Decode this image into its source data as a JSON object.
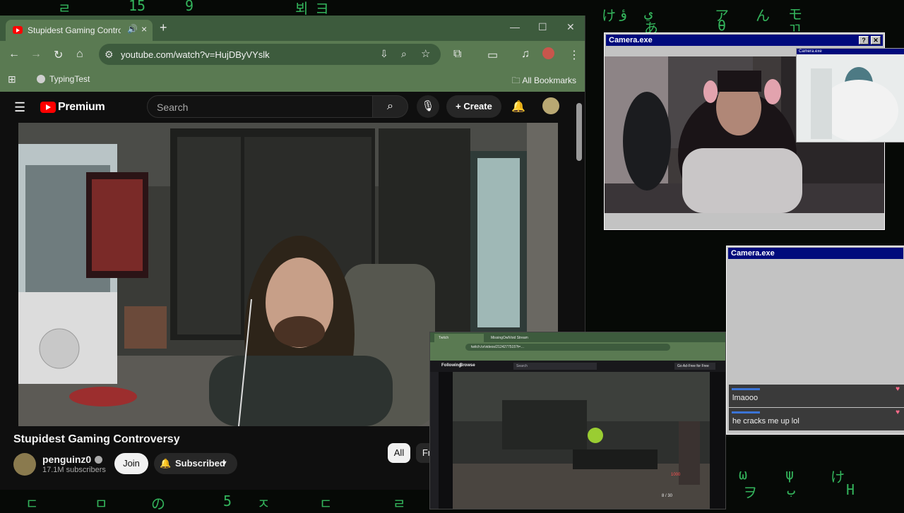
{
  "browser": {
    "tab": {
      "title": "Stupidest Gaming Controversy",
      "close_glyph": "×"
    },
    "new_tab_glyph": "+",
    "window_controls": {
      "minimize": "—",
      "maximize": "☐",
      "close": "✕"
    },
    "url": "youtube.com/watch?v=HujDByVYslk",
    "bookmarks": [
      {
        "label": "TypingTest"
      }
    ],
    "all_bookmarks_label": "All Bookmarks",
    "theme": {
      "frame": "#3d5b3d",
      "toolbar": "#5a7a52"
    }
  },
  "youtube": {
    "brand": "Premium",
    "search_placeholder": "Search",
    "create_label": "Create",
    "video_title": "Stupidest Gaming Controversy",
    "channel_name": "penguinz0",
    "subscribers": "17.1M subscribers",
    "join_label": "Join",
    "subscribed_label": "Subscribed",
    "chips": [
      "All",
      "Fr"
    ],
    "accent": "#ff0000"
  },
  "camera_windows": [
    {
      "title": "Camera.exe"
    },
    {
      "title": "Camera.exe"
    },
    {
      "title": "Camera.exe"
    }
  ],
  "camera_buttons": {
    "help": "?",
    "close": "✕"
  },
  "chat": [
    {
      "message": "lmaooo"
    },
    {
      "message": "he cracks me up lol"
    }
  ],
  "twitch": {
    "tab1": "Twitch",
    "tab2": "MissingOwlVoid Stream",
    "url": "twitch.tv/videos/2124277515?t=…",
    "nav_following": "Following",
    "nav_browse": "Browse",
    "search_placeholder": "Search",
    "ad_free": "Go Ad-Free for Free",
    "hud_health": "1000",
    "hud_ammo": "8 / 30"
  },
  "matrix_glyphs": [
    "ㄹ",
    "15",
    "9",
    "뵈",
    "ヨ",
    "け",
    "ﺅ",
    "ي",
    "ア",
    "ん",
    "モ",
    "あ",
    "θ",
    "ㄲ",
    "ω",
    "ψ",
    "け",
    "ب",
    "H",
    "ヲ",
    "ㄷ",
    "ㅁ",
    "の",
    "5",
    "ㅈ",
    "ㄷ",
    "ㄹ"
  ]
}
